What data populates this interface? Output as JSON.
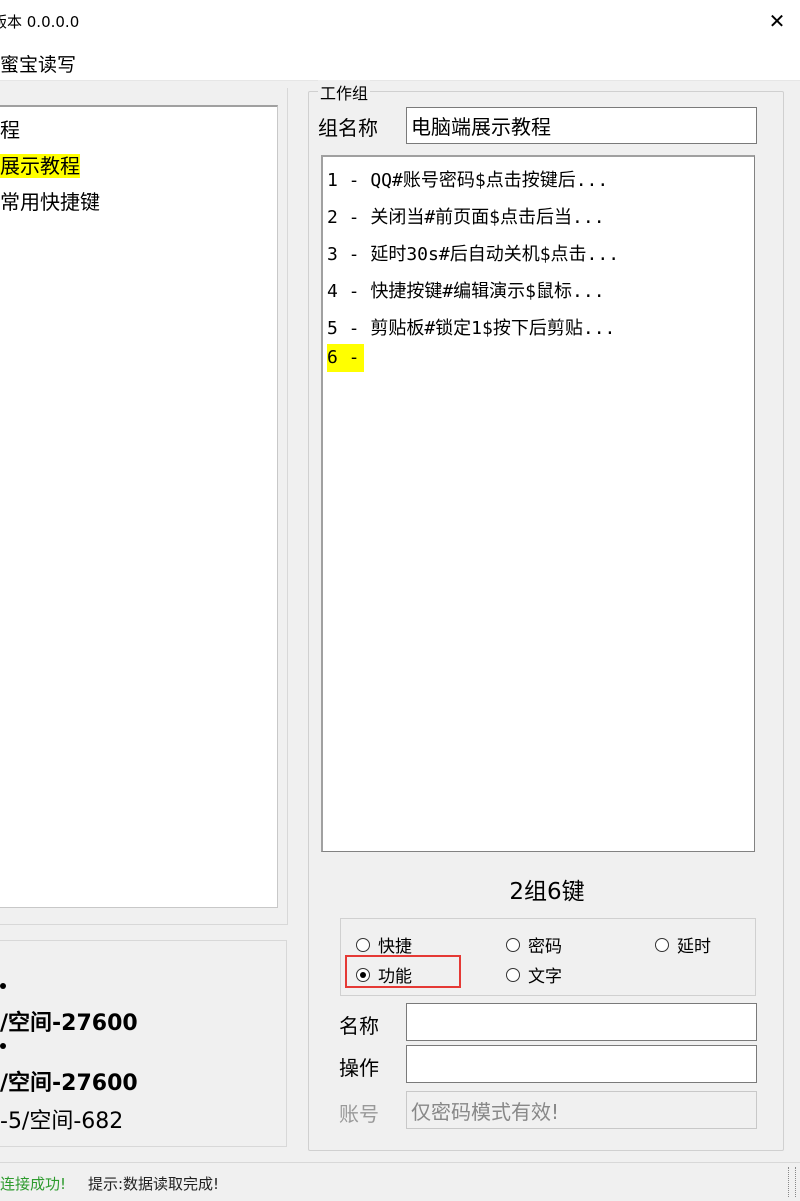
{
  "window": {
    "title": "版本 0.0.0.0",
    "close_glyph": "✕"
  },
  "menu": {
    "item": "蜜宝读写"
  },
  "tree": {
    "items": [
      {
        "label": "程",
        "highlight": false
      },
      {
        "label": "展示教程",
        "highlight": true
      },
      {
        "label": "常用快捷键",
        "highlight": false
      }
    ]
  },
  "info": {
    "lines": [
      "/空间-27600",
      "/空间-27600",
      "-5/空间-682"
    ]
  },
  "group": {
    "title": "工作组",
    "name_label": "组名称",
    "name_value": "电脑端展示教程",
    "keys": [
      "1 - QQ#账号密码$点击按键后...",
      "2 - 关闭当#前页面$点击后当...",
      "3 - 延时30s#后自动关机$点击...",
      "4 - 快捷按键#编辑演示$鼠标...",
      "5 - 剪贴板#锁定1$按下后剪贴...",
      "6 -"
    ],
    "selected_key_index": 5,
    "count_label": "2组6键"
  },
  "modes": {
    "options": [
      "快捷",
      "密码",
      "延时",
      "功能",
      "文字"
    ],
    "selected": "功能"
  },
  "fields": {
    "name_label": "名称",
    "name_value": "",
    "action_label": "操作",
    "action_value": "",
    "account_label": "账号",
    "account_placeholder": "仅密码模式有效!"
  },
  "status": {
    "connection": "连接成功!",
    "message": "提示:数据读取完成!"
  },
  "colors": {
    "highlight": "#ffff00",
    "status_ok": "#2e9b2e",
    "annotation_box": "#e53935"
  }
}
